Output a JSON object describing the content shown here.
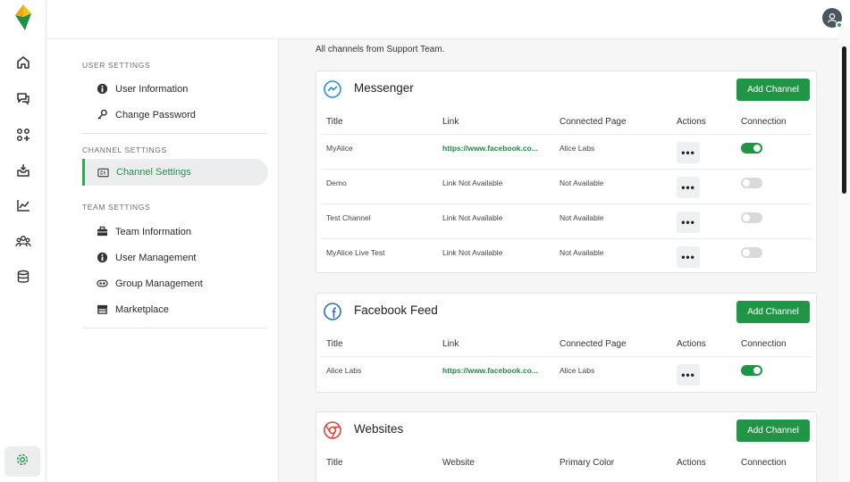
{
  "colors": {
    "brand_green": "#209546",
    "active_green": "#2fa85a",
    "logo_yellow": "#f3c21b",
    "logo_green": "#1f8f45"
  },
  "rail": {
    "icons": [
      "home-icon",
      "chat-icon",
      "apps-icon",
      "inbox-icon",
      "analytics-icon",
      "team-icon",
      "database-icon",
      "gear-icon"
    ]
  },
  "sidebar": {
    "user_settings_heading": "USER SETTINGS",
    "user_items": [
      {
        "label": "User Information",
        "icon": "user-info-icon"
      },
      {
        "label": "Change Password",
        "icon": "key-icon"
      }
    ],
    "channel_settings_heading": "CHANNEL SETTINGS",
    "active_item": {
      "label": "Channel Settings",
      "icon": "channel-icon"
    },
    "team_settings_heading": "TEAM SETTINGS",
    "team_items": [
      {
        "label": "Team Information",
        "icon": "briefcase-icon"
      },
      {
        "label": "User Management",
        "icon": "user-management-icon"
      },
      {
        "label": "Group Management",
        "icon": "group-icon"
      },
      {
        "label": "Marketplace",
        "icon": "store-icon"
      }
    ]
  },
  "main": {
    "intro": "All channels from Support Team.",
    "messenger": {
      "title": "Messenger",
      "add_label": "Add Channel",
      "headers": [
        "Title",
        "Link",
        "Connected Page",
        "Actions",
        "Connection"
      ],
      "rows": [
        {
          "title": "MyAlice",
          "link": "https://www.facebook.co...",
          "page": "Alice Labs",
          "actions": "•••",
          "connected": true
        },
        {
          "title": "Demo",
          "link": "Link Not Available",
          "page": "Not Available",
          "actions": "•••",
          "connected": false
        },
        {
          "title": "Test Channel",
          "link": "Link Not Available",
          "page": "Not Available",
          "actions": "•••",
          "connected": false
        },
        {
          "title": "MyAlice Live Test",
          "link": "Link Not Available",
          "page": "Not Available",
          "actions": "•••",
          "connected": false
        }
      ]
    },
    "facebook_feed": {
      "title": "Facebook Feed",
      "add_label": "Add Channel",
      "headers": [
        "Title",
        "Link",
        "Connected Page",
        "Actions",
        "Connection"
      ],
      "rows": [
        {
          "title": "Alice Labs",
          "link": "https://www.facebook.co...",
          "page": "Alice Labs",
          "actions": "•••",
          "connected": true
        }
      ]
    },
    "websites": {
      "title": "Websites",
      "add_label": "Add Channel",
      "headers": [
        "Title",
        "Website",
        "Primary Color",
        "Actions",
        "Connection"
      ]
    }
  }
}
